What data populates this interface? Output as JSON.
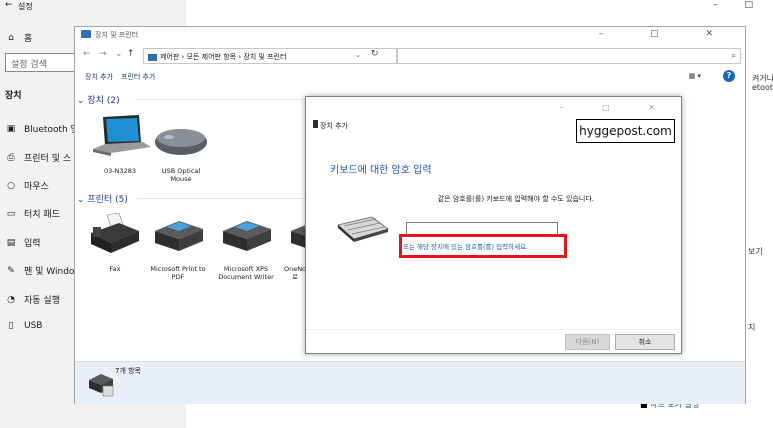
{
  "settings": {
    "back": "←",
    "title": "설정",
    "home": "홈",
    "search_placeholder": "설정 검색",
    "section": "장치",
    "items": [
      {
        "label": "Bluetooth 및"
      },
      {
        "label": "프린터 및 스"
      },
      {
        "label": "마우스"
      },
      {
        "label": "터치 패드"
      },
      {
        "label": "입력"
      },
      {
        "label": "펜 및 Window"
      },
      {
        "label": "자동 실행"
      },
      {
        "label": "USB"
      }
    ],
    "window_controls": "– □",
    "right_partial": [
      "켜거나",
      "etooth",
      "보기",
      "지",
      "하드 보기 설정"
    ]
  },
  "control_panel": {
    "title": "장치 및 프린터",
    "window_controls": "– □ ✕",
    "address": "제어판 › 모든 제어판 항목 › 장치 및 프린터",
    "toolbar": {
      "add_device": "장치 추가",
      "add_printer": "프린터 추가"
    },
    "devices_group": "장치 (2)",
    "devices": [
      "03-N3283",
      "USB Optical Mouse"
    ],
    "printers_group": "프린터 (5)",
    "printers": [
      "Fax",
      "Microsoft Print to PDF",
      "Microsoft XPS Document Writer",
      "OneNo 로"
    ],
    "status": "7개 항목"
  },
  "dialog": {
    "window_controls": "– □ ✕",
    "title": "장치 추가",
    "watermark": "hyggepost.com",
    "heading": "키보드에 대한 암호 입력",
    "description": "같은 암호를(를) 키보드에 입력해야 할 수도 있습니다.",
    "code_value": "",
    "alt_link": "또는 해당 장치에 있는 암호를(를) 입력하세요.",
    "next": "다음(N)",
    "cancel": "취소"
  }
}
